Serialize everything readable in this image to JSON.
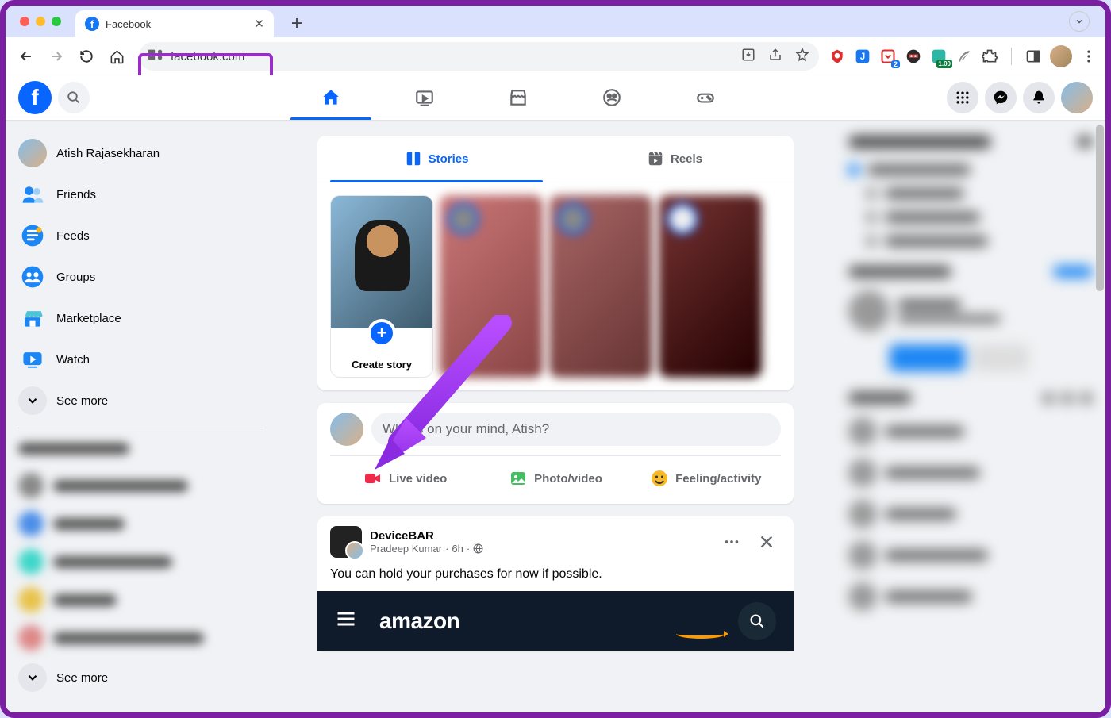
{
  "browser": {
    "tab_title": "Facebook",
    "url": "facebook.com"
  },
  "fb_header": {
    "nav_active": "home"
  },
  "left_nav": {
    "user_name": "Atish Rajasekharan",
    "items": [
      {
        "label": "Friends"
      },
      {
        "label": "Feeds"
      },
      {
        "label": "Groups"
      },
      {
        "label": "Marketplace"
      },
      {
        "label": "Watch"
      }
    ],
    "see_more": "See more",
    "bottom_see_more": "See more"
  },
  "stories": {
    "tabs": [
      {
        "label": "Stories",
        "active": true
      },
      {
        "label": "Reels",
        "active": false
      }
    ],
    "create_label": "Create story"
  },
  "composer": {
    "placeholder": "What's on your mind, Atish?",
    "actions": [
      {
        "label": "Live video",
        "color": "#f02849"
      },
      {
        "label": "Photo/video",
        "color": "#45bd62"
      },
      {
        "label": "Feeling/activity",
        "color": "#f7b928"
      }
    ]
  },
  "post": {
    "author": "DeviceBAR",
    "subauthor": "Pradeep Kumar",
    "time": "6h",
    "text": "You can hold your purchases for now if possible.",
    "embed_brand": "amazon"
  }
}
